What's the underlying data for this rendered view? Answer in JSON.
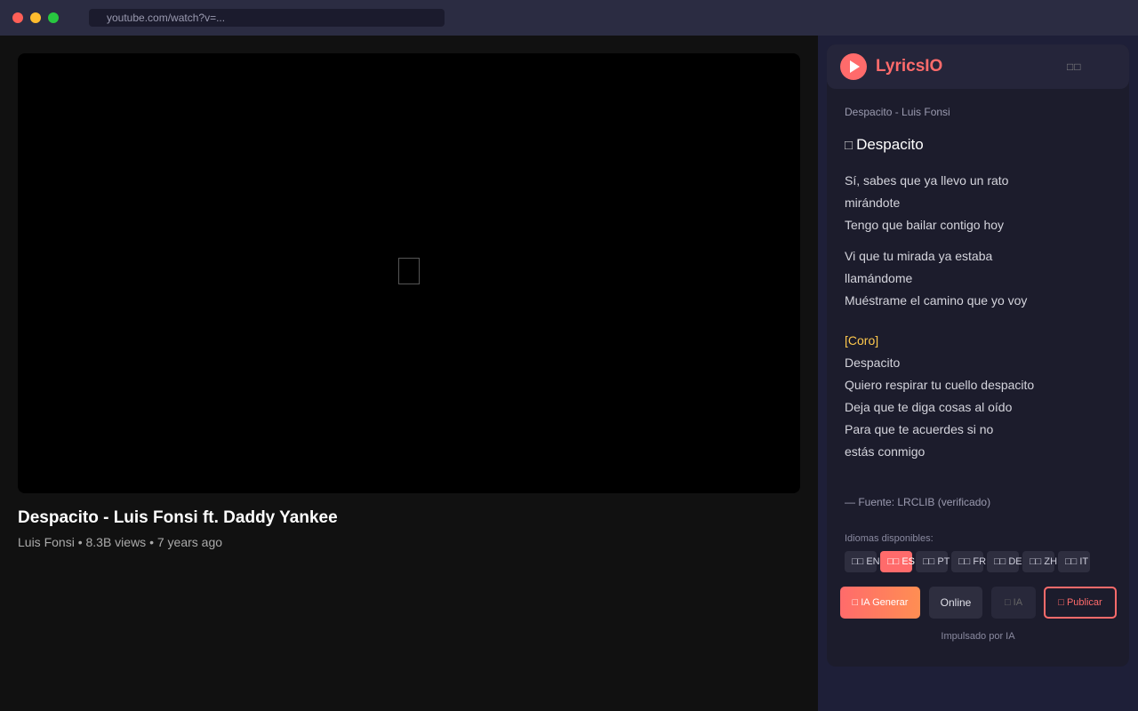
{
  "browser": {
    "url": "youtube.com/watch?v=..."
  },
  "video": {
    "title": "Despacito - Luis Fonsi ft. Daddy Yankee",
    "meta": "Luis Fonsi • 8.3B views • 7 years ago",
    "play_glyph": "▯"
  },
  "extension": {
    "brand": "LyricsIO",
    "header_icons": "□□",
    "song_subtitle": "Despacito - Luis Fonsi",
    "song_title_glyph": "□",
    "song_title": "Despacito",
    "lyrics": [
      {
        "text": "Sí, sabes que ya llevo un rato",
        "section": false
      },
      {
        "text": "mirándote",
        "section": false
      },
      {
        "text": "Tengo que bailar contigo hoy",
        "section": false
      },
      {
        "text": "Vi que tu mirada ya estaba",
        "section": false
      },
      {
        "text": "llamándome",
        "section": false
      },
      {
        "text": "Muéstrame el camino que yo voy",
        "section": false
      },
      {
        "text": "[Coro]",
        "section": true
      },
      {
        "text": "Despacito",
        "section": false
      },
      {
        "text": "Quiero respirar tu cuello despacito",
        "section": false
      },
      {
        "text": "Deja que te diga cosas al oído",
        "section": false
      },
      {
        "text": "Para que te acuerdes si no",
        "section": false
      },
      {
        "text": "estás conmigo",
        "section": false
      }
    ],
    "source": "— Fuente: LRCLIB (verificado)",
    "languages_label": "Idiomas disponibles:",
    "languages": [
      {
        "label": "□□ EN",
        "active": false
      },
      {
        "label": "□□ ES",
        "active": true
      },
      {
        "label": "□□ PT",
        "active": false
      },
      {
        "label": "□□ FR",
        "active": false
      },
      {
        "label": "□□ DE",
        "active": false
      },
      {
        "label": "□□ ZH",
        "active": false
      },
      {
        "label": "□□ IT",
        "active": false
      }
    ],
    "buttons": {
      "generate": "□ IA Generar",
      "online": "Online",
      "ia": "□ IA",
      "publish": "□ Publicar"
    },
    "powered_by": "Impulsado por IA"
  },
  "colors": {
    "accent": "#ff6b6b",
    "section": "#ffc94d"
  }
}
